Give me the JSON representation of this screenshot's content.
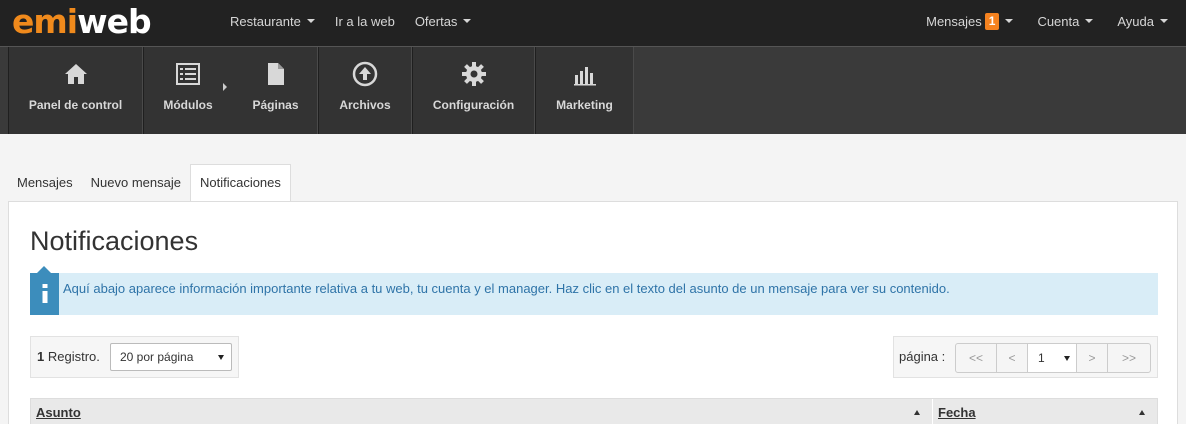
{
  "brand": {
    "part1": "emi",
    "part2": "web",
    "accent": "#f08a1c"
  },
  "topnav": {
    "left": [
      {
        "label": "Restaurante",
        "dropdown": true
      },
      {
        "label": "Ir a la web",
        "dropdown": false
      },
      {
        "label": "Ofertas",
        "dropdown": true
      }
    ],
    "right": {
      "messages_label": "Mensajes",
      "messages_count": "1",
      "account_label": "Cuenta",
      "help_label": "Ayuda"
    }
  },
  "toolbar": {
    "items": [
      {
        "label": "Panel de control",
        "icon": "home-icon"
      },
      {
        "label": "Módulos",
        "icon": "list-icon"
      },
      {
        "label": "Páginas",
        "icon": "page-icon"
      },
      {
        "label": "Archivos",
        "icon": "upload-icon"
      },
      {
        "label": "Configuración",
        "icon": "gear-icon"
      },
      {
        "label": "Marketing",
        "icon": "bar-chart-icon"
      }
    ]
  },
  "tabs": [
    {
      "label": "Mensajes",
      "active": false
    },
    {
      "label": "Nuevo mensaje",
      "active": false
    },
    {
      "label": "Notificaciones",
      "active": true
    }
  ],
  "page": {
    "title": "Notificaciones",
    "info": "Aquí abajo aparece información importante relativa a tu web, tu cuenta y el manager. Haz clic en el texto del asunto de un mensaje para ver su contenido."
  },
  "records": {
    "count": "1",
    "label": "Registro.",
    "per_page": "20 por página"
  },
  "pagination": {
    "label": "página :",
    "first": "<<",
    "prev": "<",
    "current": "1",
    "next": ">",
    "last": ">>"
  },
  "table": {
    "columns": [
      "Asunto",
      "Fecha"
    ]
  }
}
